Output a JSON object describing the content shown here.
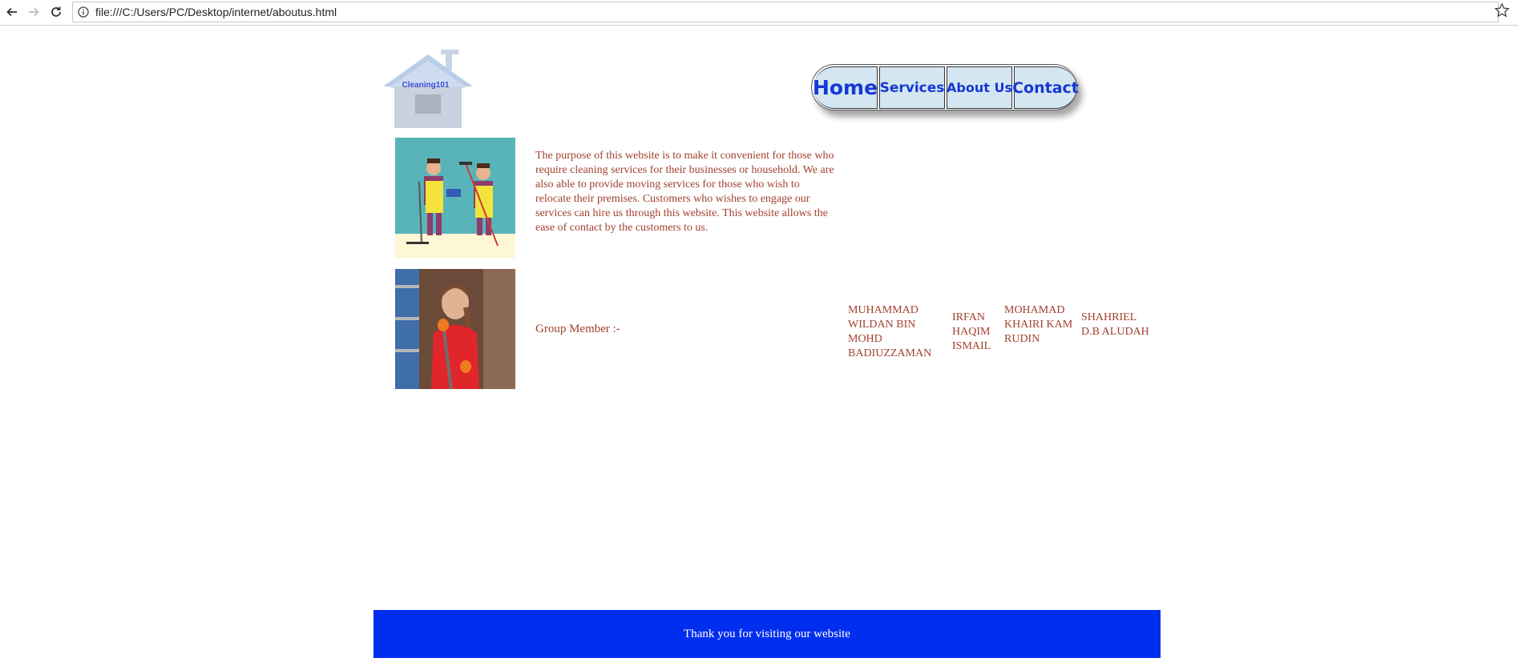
{
  "browser": {
    "url": "file:///C:/Users/PC/Desktop/internet/aboutus.html",
    "icons": [
      "back-icon",
      "forward-icon",
      "reload-icon",
      "info-icon",
      "star-icon"
    ]
  },
  "logo": {
    "text": "Cleaning101"
  },
  "nav": {
    "home": "Home",
    "services": "Services",
    "about": "About Us",
    "contact": "Contact"
  },
  "about": {
    "purpose": "The purpose of this website is to make it convenient for those who require cleaning services for their businesses or household. We are also able to provide moving services for those who wish to relocate their premises. Customers who wishes to engage our services can hire us through this website. This website allows the ease of contact by the customers to us."
  },
  "group": {
    "label": "Group Member :-",
    "members": [
      "MUHAMMAD WILDAN BIN MOHD BADIUZZAMAN",
      "IRFAN HAQIM ISMAIL",
      "MOHAMAD KHAIRI KAM RUDIN",
      "SHAHRIEL D.B ALUDAH"
    ]
  },
  "footer": {
    "text": "Thank you for visiting our website"
  },
  "colors": {
    "text": "#a0412d",
    "nav_text": "#1538d6",
    "nav_bg": "#d4e6f1",
    "footer_bg": "#002eef",
    "footer_text": "#ffffff"
  }
}
